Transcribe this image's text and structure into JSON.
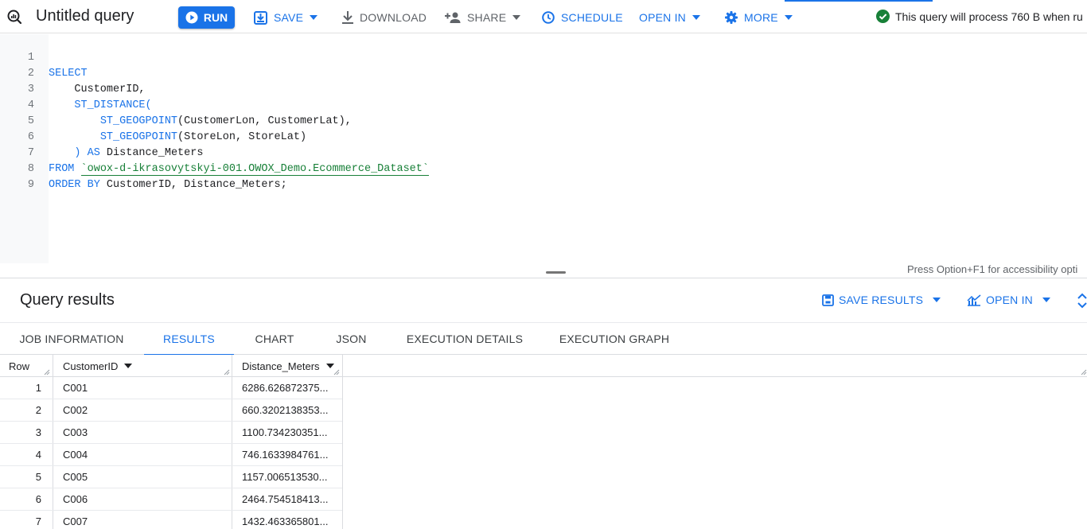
{
  "toolbar": {
    "title": "Untitled query",
    "run_label": "RUN",
    "save_label": "SAVE",
    "download_label": "DOWNLOAD",
    "share_label": "SHARE",
    "schedule_label": "SCHEDULE",
    "open_in_label": "OPEN IN",
    "more_label": "MORE",
    "status_text": "This query will process 760 B when ru",
    "icons": [
      "query-icon",
      "play-icon",
      "save-icon",
      "download-icon",
      "person-add-icon",
      "clock-icon",
      "gear-icon",
      "check-circle-icon",
      "chevron-down-icon"
    ],
    "colors": {
      "accent": "#1a73e8",
      "success": "#188038"
    }
  },
  "editor": {
    "line_numbers": [
      "1",
      "2",
      "3",
      "4",
      "5",
      "6",
      "7",
      "8",
      "9"
    ],
    "accessibility_hint": "Press Option+F1 for accessibility opti",
    "code": {
      "l1": "SELECT",
      "l2": "    CustomerID,",
      "l3_fn": "ST_DISTANCE(",
      "l4_fn": "ST_GEOGPOINT",
      "l4_rest": "(CustomerLon, CustomerLat),",
      "l5_fn": "ST_GEOGPOINT",
      "l5_rest": "(StoreLon, StoreLat)",
      "l6_paren": ")",
      "l6_as": "AS",
      "l6_rest": " Distance_Meters",
      "l7_kw": "FROM",
      "l7_table": "`owox-d-ikrasovytskyi-001.OWOX_Demo.Ecommerce_Dataset`",
      "l8_kw": "ORDER BY",
      "l8_rest": " CustomerID, Distance_Meters;"
    }
  },
  "results": {
    "title": "Query results",
    "save_results_label": "SAVE RESULTS",
    "open_in_label": "OPEN IN",
    "tabs": [
      {
        "label": "JOB INFORMATION",
        "active": false
      },
      {
        "label": "RESULTS",
        "active": true
      },
      {
        "label": "CHART",
        "active": false
      },
      {
        "label": "JSON",
        "active": false
      },
      {
        "label": "EXECUTION DETAILS",
        "active": false
      },
      {
        "label": "EXECUTION GRAPH",
        "active": false
      }
    ],
    "columns": [
      "Row",
      "CustomerID",
      "Distance_Meters"
    ],
    "rows": [
      {
        "row": "1",
        "customer_id": "C001",
        "distance": "6286.626872375..."
      },
      {
        "row": "2",
        "customer_id": "C002",
        "distance": "660.3202138353..."
      },
      {
        "row": "3",
        "customer_id": "C003",
        "distance": "1100.734230351..."
      },
      {
        "row": "4",
        "customer_id": "C004",
        "distance": "746.1633984761..."
      },
      {
        "row": "5",
        "customer_id": "C005",
        "distance": "1157.006513530..."
      },
      {
        "row": "6",
        "customer_id": "C006",
        "distance": "2464.754518413..."
      },
      {
        "row": "7",
        "customer_id": "C007",
        "distance": "1432.463365801..."
      }
    ]
  }
}
